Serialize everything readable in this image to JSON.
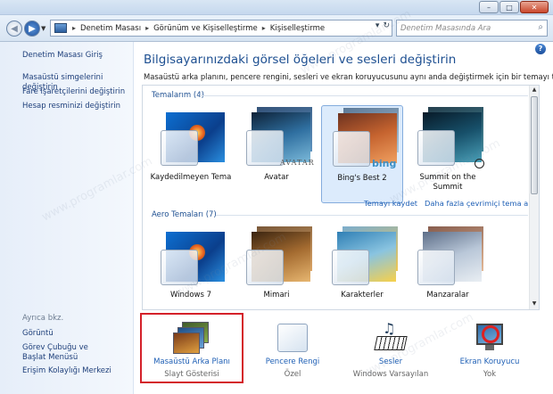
{
  "window": {
    "minimize_glyph": "–",
    "maximize_glyph": "□",
    "close_glyph": "✕"
  },
  "address_bar": {
    "crumbs": [
      "Denetim Masası",
      "Görünüm ve Kişiselleştirme",
      "Kişiselleştirme"
    ],
    "refresh_glyph": "↻",
    "search_placeholder": "Denetim Masasında Ara"
  },
  "left_pane": {
    "home_link": "Denetim Masası Giriş",
    "links": [
      "Masaüstü simgelerini değiştirin",
      "Fare işaretçilerini değiştirin",
      "Hesap resminizi değiştirin"
    ],
    "see_also_label": "Ayrıca bkz.",
    "see_also": [
      "Görüntü",
      "Görev Çubuğu ve Başlat Menüsü",
      "Erişim Kolaylığı Merkezi"
    ]
  },
  "main": {
    "help_glyph": "?",
    "title": "Bilgisayarınızdaki görsel öğeleri ve sesleri değiştirin",
    "description": "Masaüstü arka planını, pencere rengini, sesleri ve ekran koruyucusunu aynı anda değiştirmek için bir temayı tıklatın.",
    "my_themes_label": "Temalarım (4)",
    "my_themes": [
      {
        "name": "Kaydedilmeyen Tema"
      },
      {
        "name": "Avatar",
        "brand": "AVATAR"
      },
      {
        "name": "Bing's Best 2",
        "brand": "bing"
      },
      {
        "name": "Summit on the Summit"
      }
    ],
    "save_theme_link": "Temayı kaydet",
    "more_online_link": "Daha fazla çevrimiçi tema al",
    "aero_themes_label": "Aero Temaları (7)",
    "aero_themes": [
      {
        "name": "Windows 7"
      },
      {
        "name": "Mimari"
      },
      {
        "name": "Karakterler"
      },
      {
        "name": "Manzaralar"
      }
    ]
  },
  "bottom": [
    {
      "label": "Masaüstü Arka Planı",
      "value": "Slayt Gösterisi"
    },
    {
      "label": "Pencere Rengi",
      "value": "Özel"
    },
    {
      "label": "Sesler",
      "value": "Windows Varsayılan"
    },
    {
      "label": "Ekran Koruyucu",
      "value": "Yok"
    }
  ],
  "watermark": "www.programlar.com"
}
